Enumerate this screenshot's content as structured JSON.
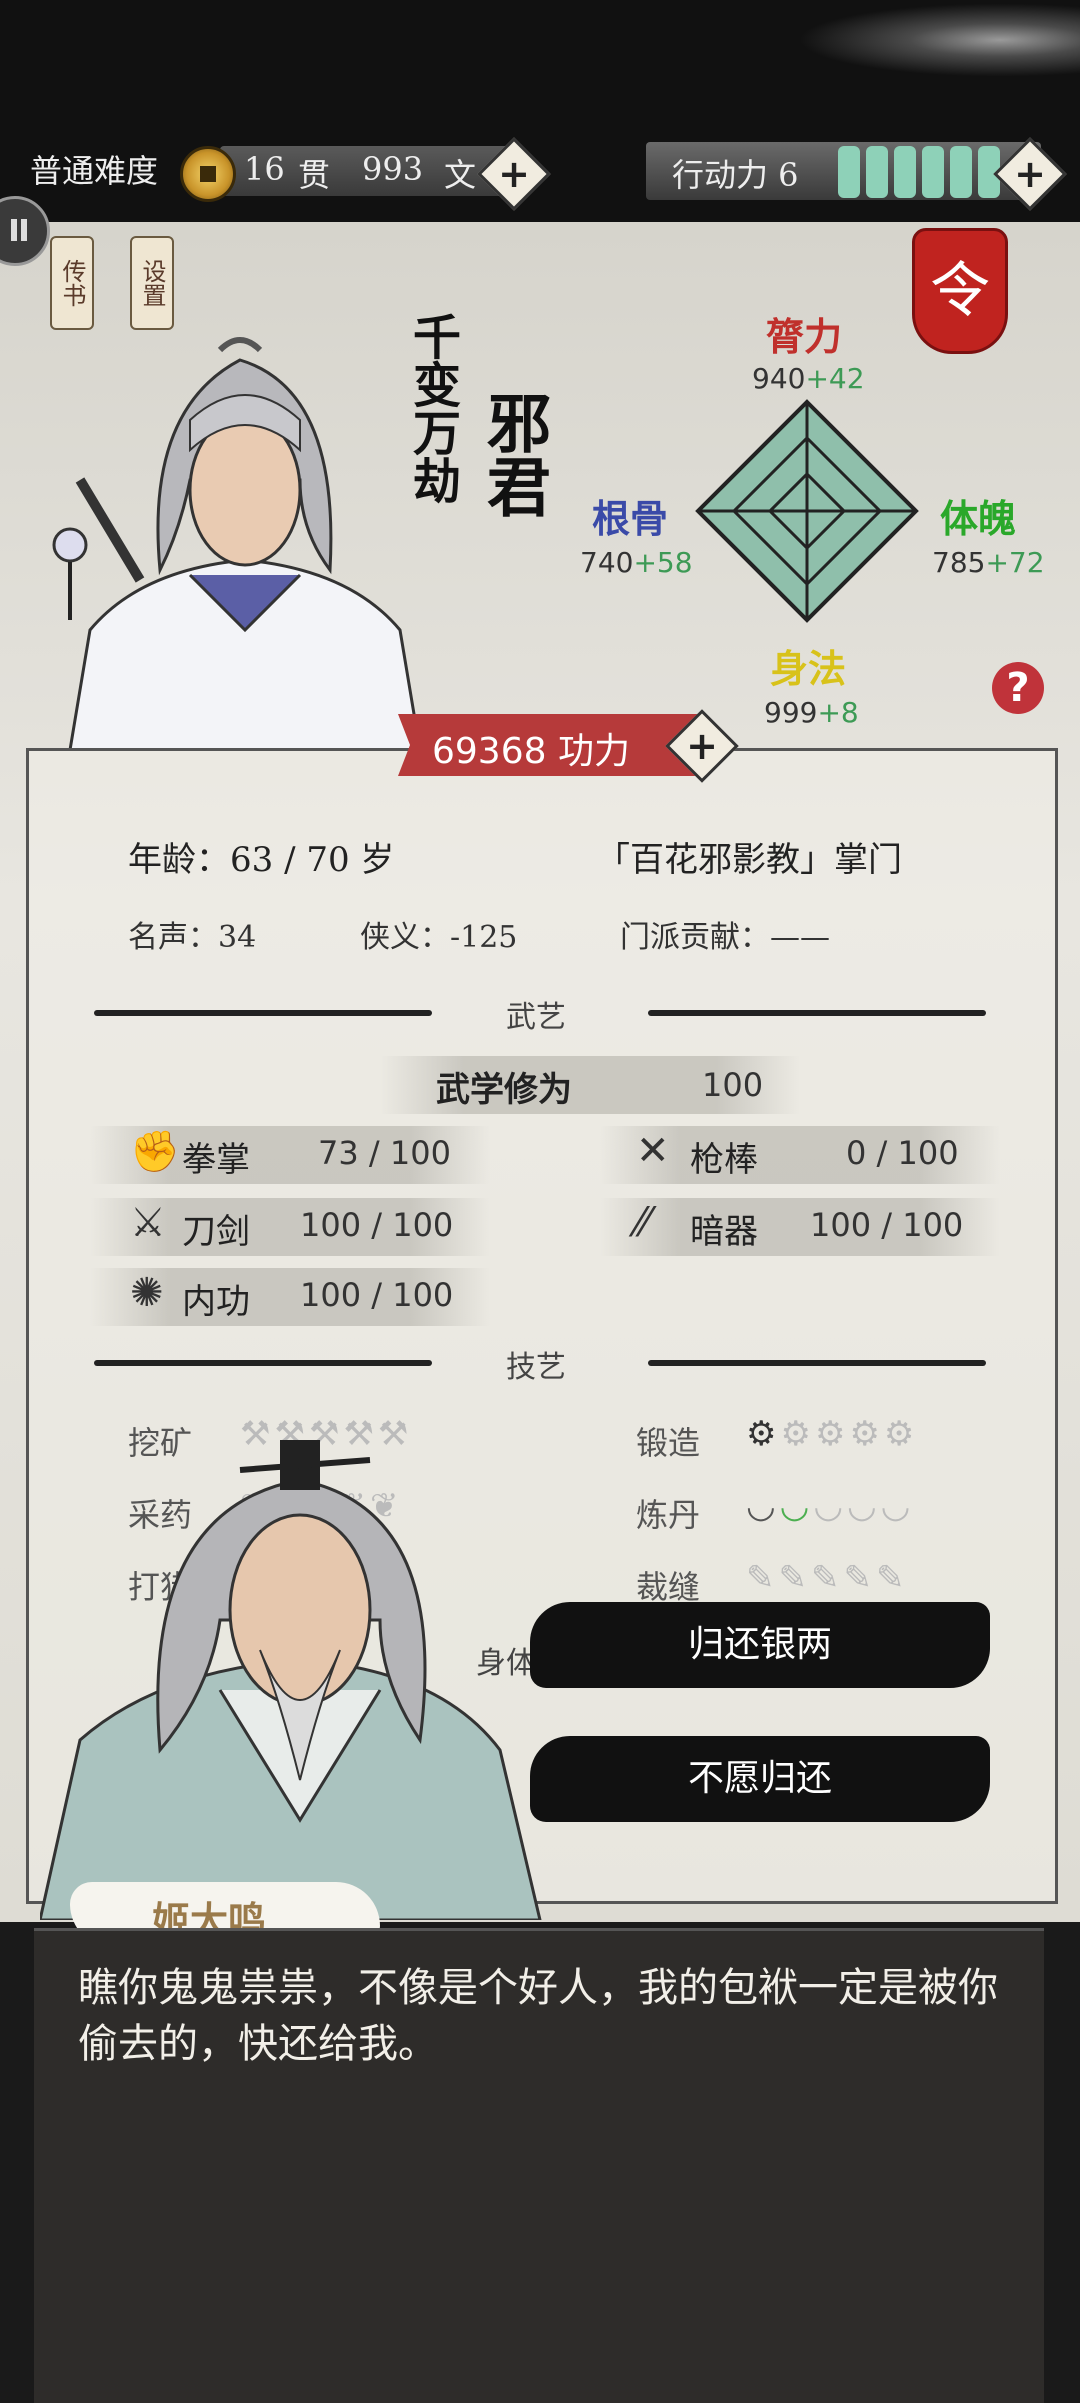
{
  "header": {
    "difficulty": "普通难度",
    "money_guan": "16",
    "money_guan_unit": "贯",
    "money_wen": "993",
    "money_wen_unit": "文",
    "action_points_label": "行动力 6",
    "action_points_segments": 6
  },
  "side_tabs": {
    "letters": "传书",
    "settings": "设置"
  },
  "order_button": "令",
  "character": {
    "nickname": "千变万劫",
    "name": "邪君",
    "power_value": "69368",
    "power_unit": "功力"
  },
  "stats": {
    "strength": {
      "label": "膂力",
      "value": "940",
      "bonus": "+42"
    },
    "constitution": {
      "label": "体魄",
      "value": "785",
      "bonus": "+72"
    },
    "agility": {
      "label": "身法",
      "value": "999",
      "bonus": "+8"
    },
    "bone": {
      "label": "根骨",
      "value": "740",
      "bonus": "+58"
    }
  },
  "info": {
    "age_label": "年龄：",
    "age_value": "63 / 70 岁",
    "sect": "「百花邪影教」掌门",
    "fame_label": "名声：",
    "fame_value": "34",
    "chivalry_label": "侠义：",
    "chivalry_value": "-125",
    "contribution_label": "门派贡献：",
    "contribution_value": "——"
  },
  "martial": {
    "section_label": "武艺",
    "cultivation_label": "武学修为",
    "cultivation_value": "100",
    "skills": [
      {
        "name": "拳掌",
        "value": "73 / 100",
        "icon": "fist-icon"
      },
      {
        "name": "枪棒",
        "value": "0 / 100",
        "icon": "spear-icon"
      },
      {
        "name": "刀剑",
        "value": "100 / 100",
        "icon": "sword-icon"
      },
      {
        "name": "暗器",
        "value": "100 / 100",
        "icon": "dart-icon"
      },
      {
        "name": "内功",
        "value": "100 / 100",
        "icon": "qi-icon"
      }
    ]
  },
  "crafts": {
    "section_label": "技艺",
    "items": [
      {
        "name": "挖矿",
        "level": 0
      },
      {
        "name": "锻造",
        "level": 1
      },
      {
        "name": "采药",
        "level": 0
      },
      {
        "name": "炼丹",
        "level": 2
      },
      {
        "name": "打猎",
        "level": 0
      },
      {
        "name": "裁缝",
        "level": 0
      }
    ],
    "partial_label_1": "身体",
    "partial_label_2": "身"
  },
  "dialog": {
    "option_1": "归还银两",
    "option_2": "不愿归还",
    "npc_name": "姬大鸣",
    "text": "瞧你鬼鬼祟祟，不像是个好人，我的包袱一定是被你偷去的，快还给我。"
  },
  "colors": {
    "accent_red": "#b63a3a",
    "bonus_green": "#3d9a55",
    "action_bar": "#8ed1b8"
  }
}
